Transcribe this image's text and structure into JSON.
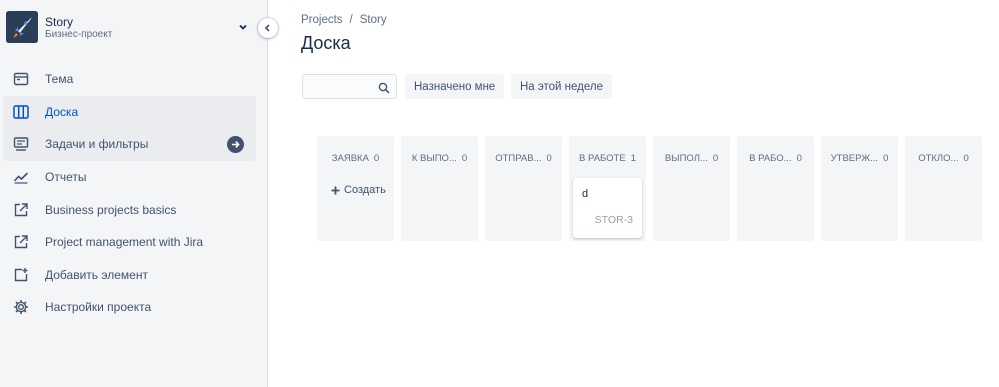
{
  "project": {
    "name": "Story",
    "type": "Бизнес-проект"
  },
  "sidebar": {
    "items": [
      {
        "label": "Тема",
        "icon": "calendar-icon"
      },
      {
        "label": "Доска",
        "icon": "board-icon"
      },
      {
        "label": "Задачи и фильтры",
        "icon": "issues-icon"
      },
      {
        "label": "Отчеты",
        "icon": "reports-chart-icon"
      },
      {
        "label": "Business projects basics",
        "icon": "external-link-icon"
      },
      {
        "label": "Project management with Jira",
        "icon": "external-link-icon"
      },
      {
        "label": "Добавить элемент",
        "icon": "add-item-icon"
      },
      {
        "label": "Настройки проекта",
        "icon": "gear-icon"
      }
    ],
    "active_index": 1
  },
  "breadcrumb": {
    "items": [
      "Projects",
      "Story"
    ],
    "separator": "/"
  },
  "page": {
    "title": "Доска"
  },
  "filters": {
    "search_value": "",
    "assigned_to_me": "Назначено мне",
    "this_week": "На этой неделе"
  },
  "board": {
    "columns": [
      {
        "name": "ЗАЯВКА",
        "count": "0",
        "create_label": "Создать"
      },
      {
        "name": "К ВЫПО...",
        "count": "0"
      },
      {
        "name": "ОТПРАВ...",
        "count": "0"
      },
      {
        "name": "В РАБОТЕ",
        "count": "1",
        "card": {
          "summary": "d",
          "key": "STOR-3"
        }
      },
      {
        "name": "ВЫПОЛ...",
        "count": "0"
      },
      {
        "name": "В РАБО...",
        "count": "0"
      },
      {
        "name": "УТВЕРЖ...",
        "count": "0"
      },
      {
        "name": "ОТКЛО...",
        "count": "0"
      }
    ]
  },
  "colors": {
    "accent": "#0052cc",
    "sidebar_bg": "#f4f5f7",
    "column_bg": "#f4f5f7",
    "text": "#172b4d",
    "muted": "#5e6c84"
  }
}
